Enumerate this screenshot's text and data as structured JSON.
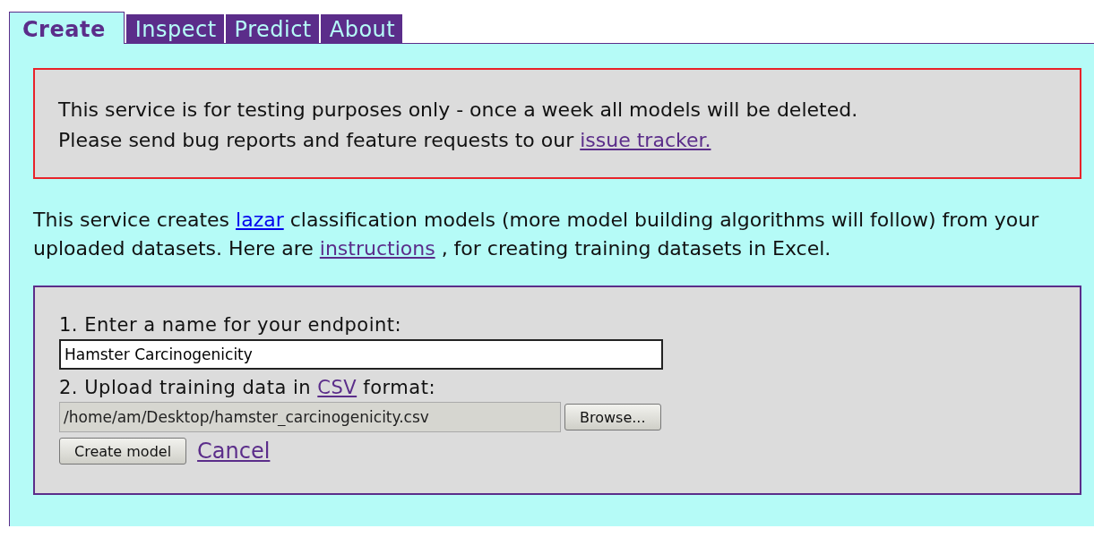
{
  "tabs": [
    {
      "label": "Create",
      "selected": true
    },
    {
      "label": "Inspect",
      "selected": false
    },
    {
      "label": "Predict",
      "selected": false
    },
    {
      "label": "About",
      "selected": false
    }
  ],
  "notice": {
    "lines": [
      [
        {
          "kind": "text",
          "text": "This service is for testing purposes only - once a week all models will be deleted."
        }
      ],
      [
        {
          "kind": "text",
          "text": "Please send bug reports and feature requests to our "
        },
        {
          "kind": "link",
          "text": "issue tracker.",
          "visited": true
        }
      ]
    ]
  },
  "intro": [
    {
      "kind": "text",
      "text": "This service creates "
    },
    {
      "kind": "link",
      "text": "lazar",
      "visited": false
    },
    {
      "kind": "text",
      "text": " classification models (more model building algorithms will follow) from your uploaded datasets. Here are "
    },
    {
      "kind": "link",
      "text": "instructions",
      "visited": true
    },
    {
      "kind": "text",
      "text": " , for creating training datasets in Excel."
    }
  ],
  "form": {
    "step_1": [
      {
        "kind": "text",
        "text": "1. Enter a name for your endpoint:"
      }
    ],
    "name_field": {
      "value": "Hamster Carcinogenicity"
    },
    "step_2": [
      {
        "kind": "text",
        "text": "2. Upload training data in "
      },
      {
        "kind": "link",
        "text": "CSV",
        "visited": true
      },
      {
        "kind": "text",
        "text": " format:"
      }
    ],
    "file_field": {
      "value": "/home/am/Desktop/hamster_carcinogenicity.csv"
    },
    "browse_button": "Browse...",
    "create_button": "Create model",
    "cancel_link": {
      "text": "Cancel",
      "visited": true
    }
  }
}
